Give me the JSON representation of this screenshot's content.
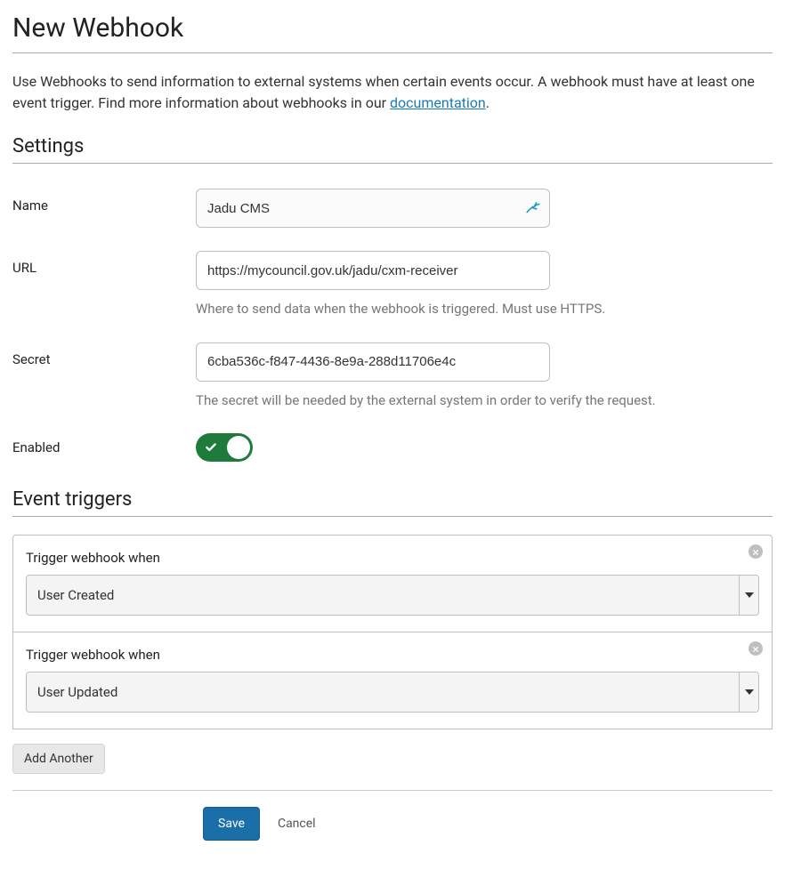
{
  "page": {
    "title": "New Webhook",
    "intro_pre": "Use Webhooks to send information to external systems when certain events occur. A webhook must have at least one event trigger. Find more information about webhooks in our ",
    "intro_link": "documentation",
    "intro_post": "."
  },
  "settings": {
    "heading": "Settings",
    "name_label": "Name",
    "name_value": "Jadu CMS",
    "url_label": "URL",
    "url_value": "https://mycouncil.gov.uk/jadu/cxm-receiver",
    "url_help": "Where to send data when the webhook is triggered. Must use HTTPS.",
    "secret_label": "Secret",
    "secret_value": "6cba536c-f847-4436-8e9a-288d11706e4c",
    "secret_help": "The secret will be needed by the external system in order to verify the request.",
    "enabled_label": "Enabled",
    "enabled_value": true
  },
  "triggers": {
    "heading": "Event triggers",
    "row_label": "Trigger webhook when",
    "items": [
      {
        "selected": "User Created"
      },
      {
        "selected": "User Updated"
      }
    ],
    "add_another_label": "Add Another"
  },
  "actions": {
    "save": "Save",
    "cancel": "Cancel"
  }
}
